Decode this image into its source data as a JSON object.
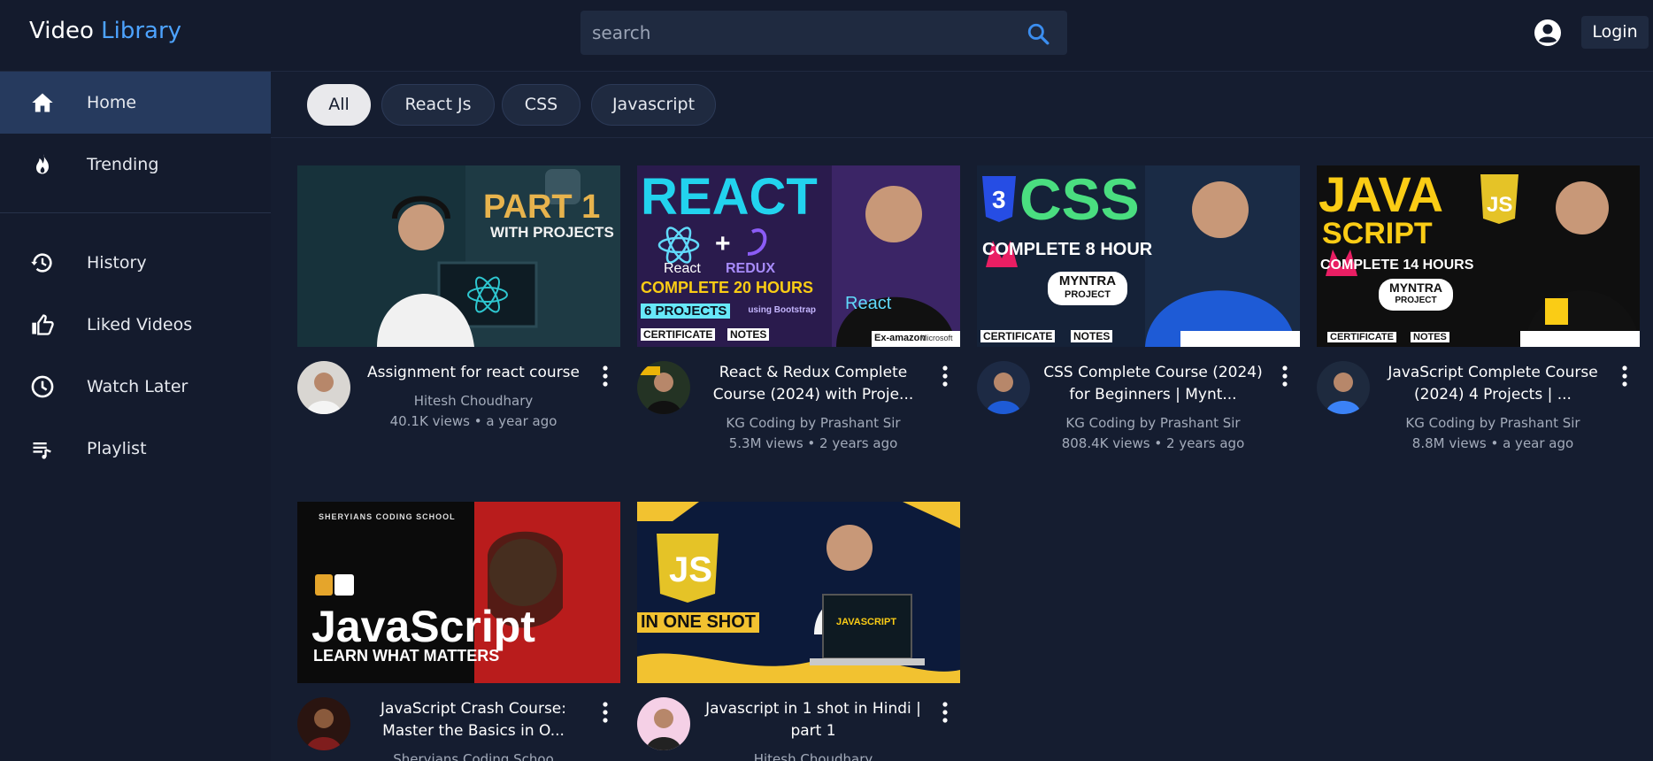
{
  "header": {
    "brand_part1": "Video",
    "brand_part2": "Library",
    "search_placeholder": "search",
    "login_label": "Login"
  },
  "sidebar": {
    "items": [
      {
        "label": "Home",
        "icon": "home-icon"
      },
      {
        "label": "Trending",
        "icon": "fire-icon"
      },
      {
        "label": "History",
        "icon": "history-icon"
      },
      {
        "label": "Liked Videos",
        "icon": "thumbs-up-icon"
      },
      {
        "label": "Watch Later",
        "icon": "clock-icon"
      },
      {
        "label": "Playlist",
        "icon": "playlist-icon"
      }
    ]
  },
  "filters": {
    "chips": [
      "All",
      "React Js",
      "CSS",
      "Javascript"
    ],
    "selected": "All"
  },
  "videos": [
    {
      "title": "Assignment for react course",
      "channel": "Hitesh Choudhary",
      "views": "40.1K views",
      "age": "a year ago",
      "meta": "40.1K views • a year ago",
      "thumb_text": "PART 1",
      "thumb_sub": "WITH PROJECTS"
    },
    {
      "title": "React & Redux Complete Course (2024) with Proje...",
      "channel": "KG Coding by Prashant Sir",
      "views": "5.3M views",
      "age": "2 years ago",
      "meta": "5.3M views • 2 years ago",
      "thumb_text": "REACT",
      "thumb_sub": "COMPLETE 20 HOURS"
    },
    {
      "title": "CSS Complete Course (2024) for Beginners | Mynt...",
      "channel": "KG Coding by Prashant Sir",
      "views": "808.4K views",
      "age": "2 years ago",
      "meta": "808.4K views • 2 years ago",
      "thumb_text": "CSS",
      "thumb_sub": "COMPLETE 8 HOUR"
    },
    {
      "title": "JavaScript Complete Course (2024) 4 Projects | ...",
      "channel": "KG Coding by Prashant Sir",
      "views": "8.8M views",
      "age": "a year ago",
      "meta": "8.8M views • a year ago",
      "thumb_text": "JAVA",
      "thumb_sub": "COMPLETE 14 HOURS"
    },
    {
      "title": "JavaScript Crash Course: Master the Basics in O...",
      "channel": "Sheryians Coding Schoo",
      "views": "",
      "age": "",
      "meta": "",
      "thumb_text": "JavaScript",
      "thumb_sub": "LEARN WHAT MATTERS"
    },
    {
      "title": "Javascript in 1 shot in Hindi | part 1",
      "channel": "Hitesh Choudhary",
      "views": "",
      "age": "",
      "meta": "",
      "thumb_text": "JS",
      "thumb_sub": "IN ONE SHOT"
    }
  ],
  "thumb_extra": {
    "v1_react": "React",
    "v1_redux": "REDUX",
    "v1_projects": "6 PROJECTS",
    "v1_cert": "CERTIFICATE",
    "v1_notes": "NOTES",
    "v1_amazon": "Ex-amazon",
    "v1_ms": "Microsoft",
    "v1_bootstrap": "using Bootstrap",
    "v1_shirt": "React",
    "v2_myntra": "MYNTRA",
    "v2_project": "PROJECT",
    "v2_cert": "CERTIFICATE",
    "v2_notes": "NOTES",
    "v3_script": "SCRIPT",
    "v3_myntra": "MYNTRA",
    "v3_project": "PROJECT",
    "v3_cert": "CERTIFICATE",
    "v3_notes": "NOTES",
    "v4_school": "SHERYIANS CODING SCHOOL",
    "v5_laptop": "JAVASCRIPT"
  },
  "colors": {
    "background": "#141b2d",
    "accent": "#4da3ff",
    "active_sidebar": "#263a5e"
  }
}
